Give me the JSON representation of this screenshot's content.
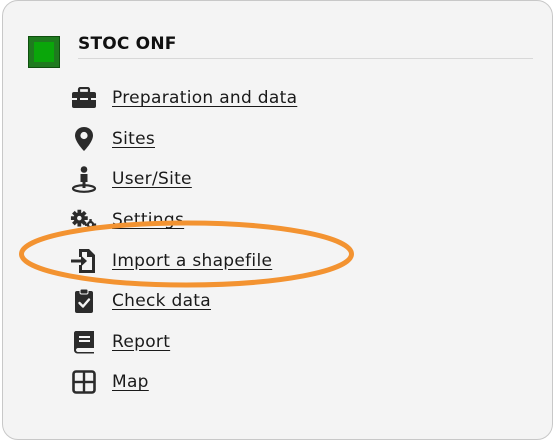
{
  "header": {
    "title": "STOC ONF"
  },
  "menu": {
    "items": [
      {
        "label": "Preparation and data",
        "icon": "toolbox-icon"
      },
      {
        "label": "Sites",
        "icon": "map-pin-icon"
      },
      {
        "label": "User/Site",
        "icon": "user-location-icon"
      },
      {
        "label": "Settings",
        "icon": "gears-icon"
      },
      {
        "label": "Import a shapefile",
        "icon": "file-import-icon"
      },
      {
        "label": "Check data",
        "icon": "clipboard-check-icon"
      },
      {
        "label": "Report",
        "icon": "book-icon"
      },
      {
        "label": "Map",
        "icon": "grid-icon"
      }
    ]
  },
  "colors": {
    "highlight_ring": "#f39331",
    "app_icon": "#1f7a1f",
    "icon": "#2b2b2b"
  }
}
